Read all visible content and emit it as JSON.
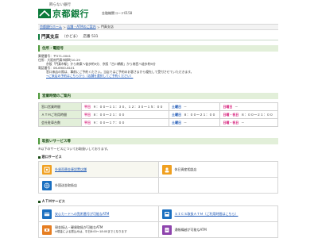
{
  "header": {
    "tagline": "飾らない銀行",
    "logo_text": "京都銀行",
    "bank_code": "金融機関コード0158",
    "brand_color": "#0b7a3a"
  },
  "breadcrumb": {
    "items": [
      "京都銀行ホーム",
      "店舗・ATMのご案内",
      "門真支店"
    ],
    "separator": ">"
  },
  "branch": {
    "name": "門真支店",
    "kana": "（かどま）",
    "code_label": "店番 531"
  },
  "sections": {
    "address_title": "住所・電話号",
    "hours_title": "営業時間のご案内",
    "services_title": "取扱いサービス等"
  },
  "address": {
    "postal": "郵便番号：〒571-0041",
    "address_line": "住所：大阪府門真市柳町10-29",
    "access_line": "京阪「門真市駅」から南東へ徒歩約9分、京阪「古川橋駅」から南西へ徒歩約9分",
    "tel": "電話番号：06-6900-8101",
    "note": "窓口来店の際は、事前にご予約ください。当店ではご予約のお客さまから優先して受付させていただきます。",
    "reserve_link": "→ご来店の予約はこちらから（店舗を選択してご予約ください）"
  },
  "hours": [
    {
      "label": "窓口営業時間",
      "weekday_day": "平日",
      "weekday_time": "９：００～１１：３０、１２：３０～１５：００",
      "sat_day": "土曜日",
      "sat_time": "－",
      "hol_day": "日曜日",
      "hol_time": "－"
    },
    {
      "label": "ＡＴＭご利用時間",
      "weekday_day": "平日",
      "weekday_time": "８：００～２１：００",
      "sat_day": "土曜日",
      "sat_time": "８：００～２１：００",
      "hol_day": "日曜・祝日",
      "hol_time": "８：００～２１：００"
    },
    {
      "label": "会社駐車台数",
      "weekday_day": "平日",
      "weekday_time": "９：００～１７：００",
      "sat_day": "土曜日",
      "sat_time": "－",
      "hol_day": "日曜・祝日",
      "hol_time": "－"
    }
  ],
  "services": {
    "intro": "※以下のサービスについてお取扱いしております。",
    "window_head": "窓口サービス",
    "window_items": [
      {
        "label": "外貨両替金庫設置店舗",
        "icon": "currency-safe-icon",
        "color": "#f0a020",
        "link": true
      },
      {
        "label": "休日資産相談店",
        "icon": "consult-icon",
        "color": "#2a9d5a",
        "link": false
      },
      {
        "label": "外国送金取扱店",
        "icon": "foreign-remit-icon",
        "color": "#1a6fc0",
        "link": false
      }
    ],
    "atm_head": "ＡＴＭサービス",
    "atm_items": [
      {
        "label": "安心カードへの覧附番号が可能なATM",
        "icon": "card-security-icon",
        "color": "#1a6fc0",
        "link": true
      },
      {
        "label": "ＳＩＣＳ取扱ＡＴＭ（ご利用時間はこちら）",
        "icon": "atm-network-icon",
        "color": "#1a6fc0",
        "link": true
      },
      {
        "label": "現金振込・硬貨取扱が可能なATM",
        "icon": "cash-deposit-icon",
        "color": "#e67e22",
        "link": false,
        "note1": "※現金による振込みは、平日8:00～18:00までとなります",
        "note2": ""
      },
      {
        "label": "通帳繰越が可能なATM",
        "icon": "passbook-icon",
        "color": "#8e44ad",
        "link": false
      }
    ]
  }
}
